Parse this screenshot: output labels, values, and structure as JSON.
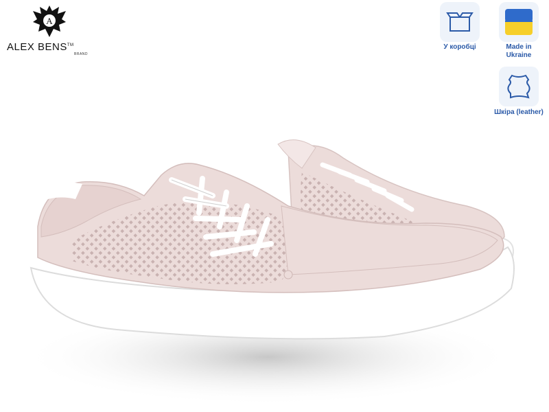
{
  "brand": {
    "name": "ALEX BENS",
    "trademark": "TM",
    "tagline": "BRAND"
  },
  "badges": [
    {
      "label": "У коробці",
      "icon": "box-icon"
    },
    {
      "label": "Made in Ukraine",
      "line1": "Made in",
      "line2": "Ukraine",
      "icon": "ukraine-flag-icon"
    },
    {
      "label": "Шкіра (leather)",
      "icon": "leather-hide-icon"
    }
  ],
  "colors": {
    "badge_bg": "#eef3fa",
    "badge_text": "#2b5aa8",
    "flag_blue": "#2f6bcb",
    "flag_yellow": "#f6cf2a",
    "shoe_pink": "#ecdcda",
    "sole": "#ffffff"
  },
  "product": {
    "subject": "pink perforated leather sneakers with white laces and white sole"
  }
}
